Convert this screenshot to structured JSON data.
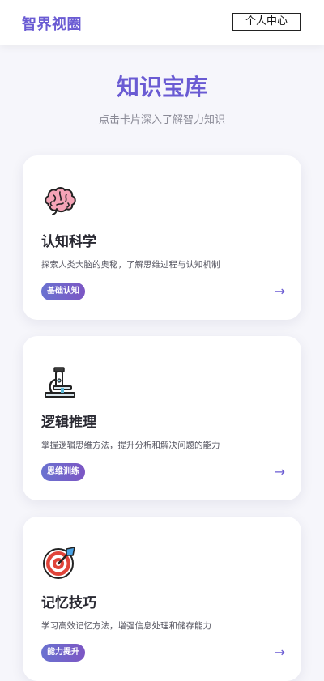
{
  "header": {
    "brand": "智界视圈",
    "profile_label": "个人中心"
  },
  "hero": {
    "title": "知识宝库",
    "subtitle": "点击卡片深入了解智力知识"
  },
  "cards": [
    {
      "icon": "brain-icon",
      "title": "认知科学",
      "description": "探索人类大脑的奥秘，了解思维过程与认知机制",
      "tag": "基础认知",
      "arrow": "→"
    },
    {
      "icon": "microscope-icon",
      "title": "逻辑推理",
      "description": "掌握逻辑思维方法，提升分析和解决问题的能力",
      "tag": "思维训练",
      "arrow": "→"
    },
    {
      "icon": "target-icon",
      "title": "记忆技巧",
      "description": "学习高效记忆方法，增强信息处理和储存能力",
      "tag": "能力提升",
      "arrow": "→"
    }
  ],
  "colors": {
    "brand": "#6a5bd3",
    "background": "#f6f6fb",
    "tag_gradient_start": "#6a72d0",
    "tag_gradient_end": "#7c56c4"
  }
}
